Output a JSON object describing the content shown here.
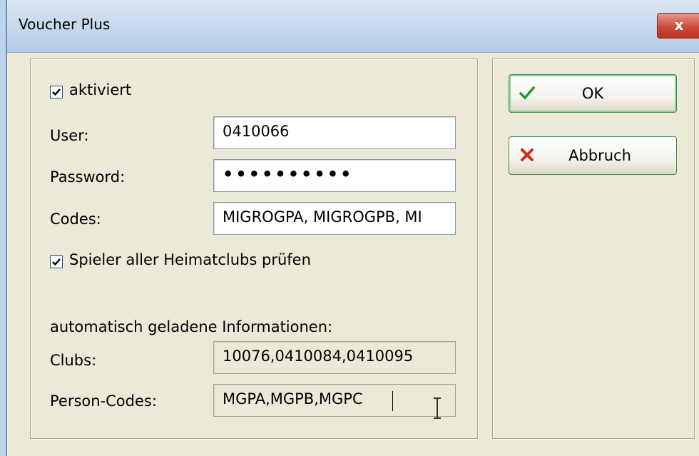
{
  "window": {
    "title": "Voucher Plus",
    "close_label": "x"
  },
  "form": {
    "aktiviert": {
      "label": "aktiviert",
      "checked": true
    },
    "user": {
      "label": "User:",
      "value": "0410066"
    },
    "password": {
      "label": "Password:",
      "masked": "••••••••••"
    },
    "codes": {
      "label": "Codes:",
      "value": "MIGROGPA, MIGROGPB, MI"
    },
    "all_clubs": {
      "label": "Spieler aller Heimatclubs prüfen",
      "checked": true
    },
    "auto_heading": "automatisch geladene Informationen:",
    "clubs": {
      "label": "Clubs:",
      "value": "10076,0410084,0410095"
    },
    "person_codes": {
      "label": "Person-Codes:",
      "value": "MGPA,MGPB,MGPC"
    }
  },
  "buttons": {
    "ok": {
      "label": "OK",
      "icon": "checkmark-icon",
      "color": "#1f9a2a"
    },
    "cancel": {
      "label": "Abbruch",
      "icon": "x-icon",
      "color": "#d62a1a"
    }
  }
}
